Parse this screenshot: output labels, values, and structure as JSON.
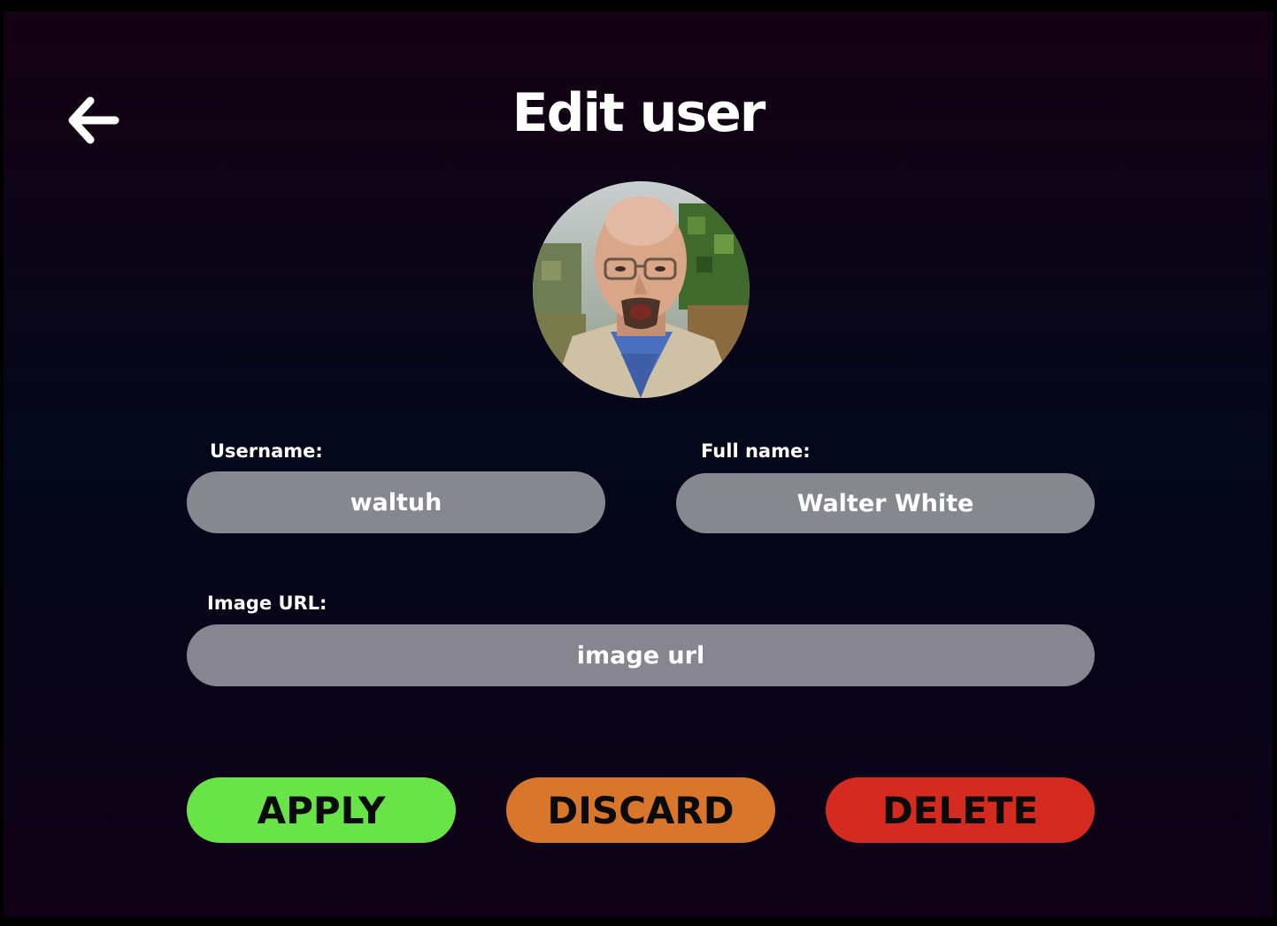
{
  "header": {
    "title": "Edit user",
    "back_icon": "arrow-left-icon"
  },
  "avatar": {
    "icon": "user-avatar-photo"
  },
  "form": {
    "username": {
      "label": "Username:",
      "value": "waltuh"
    },
    "full_name": {
      "label": "Full name:",
      "value": "Walter White"
    },
    "image_url": {
      "label": "Image URL:",
      "placeholder": "image url",
      "value": ""
    }
  },
  "actions": {
    "apply": {
      "label": "APPLY",
      "color": "#68e448"
    },
    "discard": {
      "label": "DISCARD",
      "color": "#d8772b"
    },
    "delete": {
      "label": "DELETE",
      "color": "#d52a20"
    }
  },
  "colors": {
    "background_top": "#140112",
    "background_mid": "#03081a",
    "input_fill": "#868890",
    "text": "#ffffff"
  }
}
